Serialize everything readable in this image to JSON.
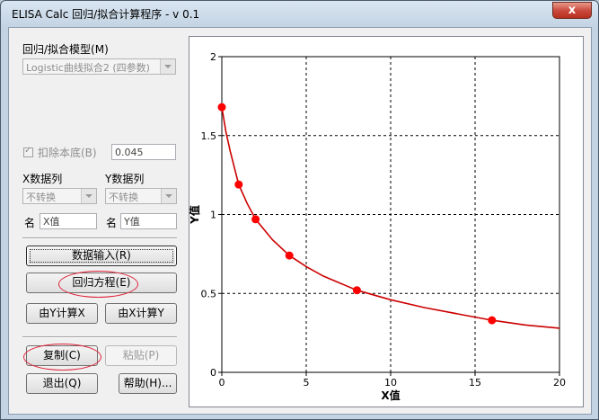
{
  "window": {
    "title": "ELISA Calc 回归/拟合计算程序 - v 0.1",
    "close_glyph": "x"
  },
  "model": {
    "label": "回归/拟合模型(M)",
    "selected": "Logistic曲线拟合2 (四参数)"
  },
  "background": {
    "label": "扣除本底(B)",
    "checked": true,
    "value": "0.045"
  },
  "x_col": {
    "label": "X数据列",
    "selected": "不转换",
    "name_label": "名",
    "name_value": "X值"
  },
  "y_col": {
    "label": "Y数据列",
    "selected": "不转换",
    "name_label": "名",
    "name_value": "Y值"
  },
  "buttons": {
    "data_input": "数据输入(R)",
    "regression": "回归方程(E)",
    "calc_x_from_y": "由Y计算X",
    "calc_y_from_x": "由X计算Y",
    "copy": "复制(C)",
    "paste": "粘贴(P)",
    "exit": "退出(Q)",
    "help": "帮助(H)..."
  },
  "chart_data": {
    "type": "scatter",
    "xlabel": "X值",
    "ylabel": "Y值",
    "xlim": [
      0,
      20
    ],
    "ylim": [
      0,
      2
    ],
    "xticks": [
      0,
      5,
      10,
      15,
      20
    ],
    "yticks": [
      0,
      0.5,
      1,
      1.5,
      2
    ],
    "grid": true,
    "point_color": "#ff0000",
    "curve_color": "#cc0000",
    "points": [
      {
        "x": 0,
        "y": 1.68
      },
      {
        "x": 1,
        "y": 1.19
      },
      {
        "x": 2,
        "y": 0.97
      },
      {
        "x": 4,
        "y": 0.74
      },
      {
        "x": 8,
        "y": 0.52
      },
      {
        "x": 16,
        "y": 0.33
      }
    ],
    "curve": [
      [
        0,
        1.68
      ],
      [
        0.25,
        1.52
      ],
      [
        0.5,
        1.4
      ],
      [
        1,
        1.19
      ],
      [
        1.5,
        1.07
      ],
      [
        2,
        0.97
      ],
      [
        3,
        0.84
      ],
      [
        4,
        0.74
      ],
      [
        5,
        0.67
      ],
      [
        6,
        0.61
      ],
      [
        8,
        0.52
      ],
      [
        10,
        0.46
      ],
      [
        12,
        0.41
      ],
      [
        14,
        0.37
      ],
      [
        16,
        0.33
      ],
      [
        18,
        0.3
      ],
      [
        20,
        0.28
      ]
    ]
  }
}
